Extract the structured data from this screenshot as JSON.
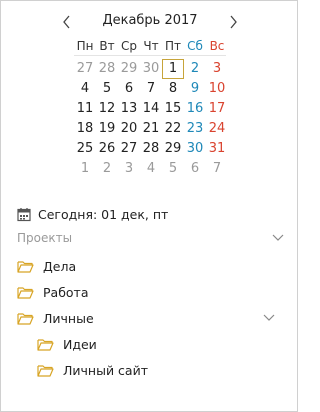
{
  "calendar": {
    "month_label": "Декабрь 2017",
    "weekdays": [
      "Пн",
      "Вт",
      "Ср",
      "Чт",
      "Пт",
      "Сб",
      "Вс"
    ],
    "weeks": [
      [
        "27",
        "28",
        "29",
        "30",
        "1",
        "2",
        "3"
      ],
      [
        "4",
        "5",
        "6",
        "7",
        "8",
        "9",
        "10"
      ],
      [
        "11",
        "12",
        "13",
        "14",
        "15",
        "16",
        "17"
      ],
      [
        "18",
        "19",
        "20",
        "21",
        "22",
        "23",
        "24"
      ],
      [
        "25",
        "26",
        "27",
        "28",
        "29",
        "30",
        "31"
      ],
      [
        "1",
        "2",
        "3",
        "4",
        "5",
        "6",
        "7"
      ]
    ],
    "today_cell": [
      0,
      4
    ],
    "colors": {
      "weekend_sat": "#1e88b8",
      "weekend_sun": "#d9432f",
      "today_border": "#c7a43a",
      "muted": "#9a9a9a"
    }
  },
  "today": {
    "label": "Сегодня: 01 дек, пт"
  },
  "sidebar": {
    "section_title": "Проекты",
    "items": [
      {
        "label": "Дела"
      },
      {
        "label": "Работа"
      },
      {
        "label": "Личные"
      },
      {
        "label": "Идеи"
      },
      {
        "label": "Личный сайт"
      }
    ]
  },
  "folder_color": "#d8a526"
}
